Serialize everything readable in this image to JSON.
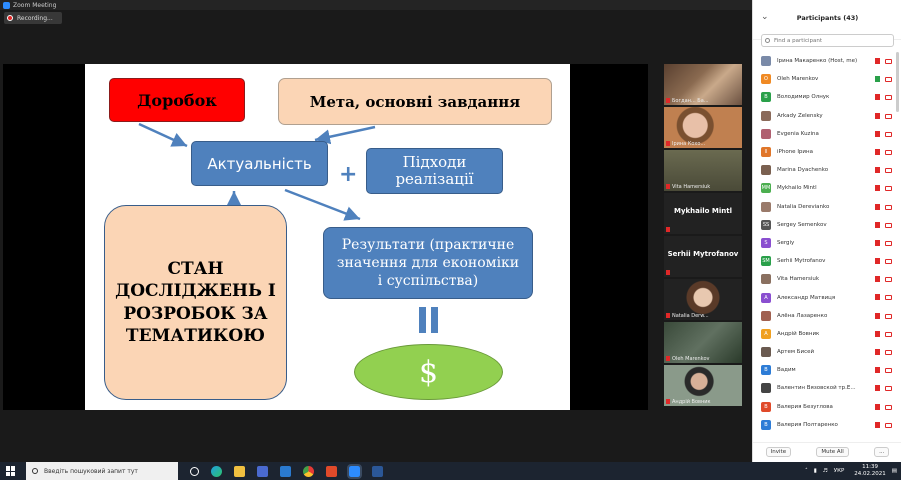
{
  "window": {
    "title": "Zoom Meeting",
    "recording_label": "Recording..."
  },
  "slide": {
    "dorobok": "Доробок",
    "meta": "Мета, основні завдання",
    "aktualnist": "Актуальність",
    "plus": "+",
    "pidkhody_line1": "Підходи",
    "pidkhody_line2": "реалізації",
    "stan_line1": "СТАН",
    "stan_line2": "ДОСЛІДЖЕНЬ І",
    "stan_line3": "РОЗРОБОК ЗА",
    "stan_line4": "ТЕМАТИКОЮ",
    "result_line1": "Результати (практичне",
    "result_line2": "значення для економіки",
    "result_line3": "і суспільства)",
    "dollar": "$"
  },
  "video_tiles": [
    {
      "name": "Богдан... Ба..."
    },
    {
      "name": "Ірина Кохо..."
    },
    {
      "name": "Vita Hamersiuk"
    },
    {
      "name": "Mykhailo Mintl"
    },
    {
      "name": "Serhii Mytrofanov"
    },
    {
      "name": "Natalia Derw..."
    },
    {
      "name": "Oleh Marenkov"
    },
    {
      "name": "Андрій Вовник"
    }
  ],
  "participants": {
    "title": "Participants (43)",
    "search_placeholder": "Find a participant",
    "list": [
      {
        "name": "Ірина Макаренко (Host, me)",
        "initials": "",
        "color": "#7a8aa8"
      },
      {
        "name": "Oleh Marenkov",
        "initials": "O",
        "color": "#f08a24"
      },
      {
        "name": "Володимир Олнук",
        "initials": "В",
        "color": "#2aa04a"
      },
      {
        "name": "Arkady Zelensky",
        "initials": "",
        "color": "#8a6a5a"
      },
      {
        "name": "Evgenia Kuzina",
        "initials": "",
        "color": "#b06070"
      },
      {
        "name": "iPhone Ірина",
        "initials": "II",
        "color": "#e0762a"
      },
      {
        "name": "Marina Dyachenko",
        "initials": "",
        "color": "#7a6050"
      },
      {
        "name": "Mykhailo Mintl",
        "initials": "MM",
        "color": "#4caf50"
      },
      {
        "name": "Natalia Derevianko",
        "initials": "",
        "color": "#9a7a6a"
      },
      {
        "name": "Sergey Semenkov",
        "initials": "SS",
        "color": "#555"
      },
      {
        "name": "Sergiy",
        "initials": "S",
        "color": "#8a4fd0"
      },
      {
        "name": "Serhii Mytrofanov",
        "initials": "SM",
        "color": "#2aa04a"
      },
      {
        "name": "Vita Hamersiuk",
        "initials": "",
        "color": "#8a7060"
      },
      {
        "name": "Александр Матвиця",
        "initials": "А",
        "color": "#8a4fd0"
      },
      {
        "name": "Алёна Лазаренко",
        "initials": "",
        "color": "#a06050"
      },
      {
        "name": "Андрій Вовник",
        "initials": "А",
        "color": "#f0a020"
      },
      {
        "name": "Артем Бисей",
        "initials": "",
        "color": "#6a5a50"
      },
      {
        "name": "Вадим",
        "initials": "В",
        "color": "#2d7cd6"
      },
      {
        "name": "Валентин Вязовской тр.Е...",
        "initials": "",
        "color": "#444"
      },
      {
        "name": "Валерия Безуглова",
        "initials": "В",
        "color": "#e04a2a"
      },
      {
        "name": "Валерия Полтаренко",
        "initials": "В",
        "color": "#2d7cd6"
      }
    ],
    "invite_label": "Invite",
    "mute_all_label": "Mute All",
    "more_label": "..."
  },
  "taskbar": {
    "search_placeholder": "Введіть пошуковий запит тут",
    "lang": "УКР",
    "time": "11:39",
    "date": "24.02.2021"
  }
}
